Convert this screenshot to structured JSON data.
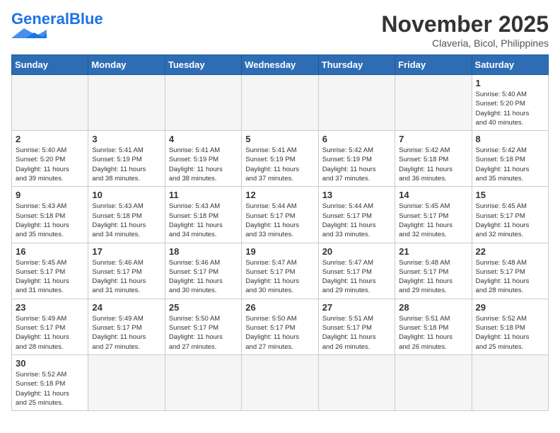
{
  "header": {
    "logo_general": "General",
    "logo_blue": "Blue",
    "month_title": "November 2025",
    "subtitle": "Claveria, Bicol, Philippines"
  },
  "weekdays": [
    "Sunday",
    "Monday",
    "Tuesday",
    "Wednesday",
    "Thursday",
    "Friday",
    "Saturday"
  ],
  "weeks": [
    [
      {
        "day": "",
        "info": ""
      },
      {
        "day": "",
        "info": ""
      },
      {
        "day": "",
        "info": ""
      },
      {
        "day": "",
        "info": ""
      },
      {
        "day": "",
        "info": ""
      },
      {
        "day": "",
        "info": ""
      },
      {
        "day": "1",
        "info": "Sunrise: 5:40 AM\nSunset: 5:20 PM\nDaylight: 11 hours\nand 40 minutes."
      }
    ],
    [
      {
        "day": "2",
        "info": "Sunrise: 5:40 AM\nSunset: 5:20 PM\nDaylight: 11 hours\nand 39 minutes."
      },
      {
        "day": "3",
        "info": "Sunrise: 5:41 AM\nSunset: 5:19 PM\nDaylight: 11 hours\nand 38 minutes."
      },
      {
        "day": "4",
        "info": "Sunrise: 5:41 AM\nSunset: 5:19 PM\nDaylight: 11 hours\nand 38 minutes."
      },
      {
        "day": "5",
        "info": "Sunrise: 5:41 AM\nSunset: 5:19 PM\nDaylight: 11 hours\nand 37 minutes."
      },
      {
        "day": "6",
        "info": "Sunrise: 5:42 AM\nSunset: 5:19 PM\nDaylight: 11 hours\nand 37 minutes."
      },
      {
        "day": "7",
        "info": "Sunrise: 5:42 AM\nSunset: 5:18 PM\nDaylight: 11 hours\nand 36 minutes."
      },
      {
        "day": "8",
        "info": "Sunrise: 5:42 AM\nSunset: 5:18 PM\nDaylight: 11 hours\nand 35 minutes."
      }
    ],
    [
      {
        "day": "9",
        "info": "Sunrise: 5:43 AM\nSunset: 5:18 PM\nDaylight: 11 hours\nand 35 minutes."
      },
      {
        "day": "10",
        "info": "Sunrise: 5:43 AM\nSunset: 5:18 PM\nDaylight: 11 hours\nand 34 minutes."
      },
      {
        "day": "11",
        "info": "Sunrise: 5:43 AM\nSunset: 5:18 PM\nDaylight: 11 hours\nand 34 minutes."
      },
      {
        "day": "12",
        "info": "Sunrise: 5:44 AM\nSunset: 5:17 PM\nDaylight: 11 hours\nand 33 minutes."
      },
      {
        "day": "13",
        "info": "Sunrise: 5:44 AM\nSunset: 5:17 PM\nDaylight: 11 hours\nand 33 minutes."
      },
      {
        "day": "14",
        "info": "Sunrise: 5:45 AM\nSunset: 5:17 PM\nDaylight: 11 hours\nand 32 minutes."
      },
      {
        "day": "15",
        "info": "Sunrise: 5:45 AM\nSunset: 5:17 PM\nDaylight: 11 hours\nand 32 minutes."
      }
    ],
    [
      {
        "day": "16",
        "info": "Sunrise: 5:45 AM\nSunset: 5:17 PM\nDaylight: 11 hours\nand 31 minutes."
      },
      {
        "day": "17",
        "info": "Sunrise: 5:46 AM\nSunset: 5:17 PM\nDaylight: 11 hours\nand 31 minutes."
      },
      {
        "day": "18",
        "info": "Sunrise: 5:46 AM\nSunset: 5:17 PM\nDaylight: 11 hours\nand 30 minutes."
      },
      {
        "day": "19",
        "info": "Sunrise: 5:47 AM\nSunset: 5:17 PM\nDaylight: 11 hours\nand 30 minutes."
      },
      {
        "day": "20",
        "info": "Sunrise: 5:47 AM\nSunset: 5:17 PM\nDaylight: 11 hours\nand 29 minutes."
      },
      {
        "day": "21",
        "info": "Sunrise: 5:48 AM\nSunset: 5:17 PM\nDaylight: 11 hours\nand 29 minutes."
      },
      {
        "day": "22",
        "info": "Sunrise: 5:48 AM\nSunset: 5:17 PM\nDaylight: 11 hours\nand 28 minutes."
      }
    ],
    [
      {
        "day": "23",
        "info": "Sunrise: 5:49 AM\nSunset: 5:17 PM\nDaylight: 11 hours\nand 28 minutes."
      },
      {
        "day": "24",
        "info": "Sunrise: 5:49 AM\nSunset: 5:17 PM\nDaylight: 11 hours\nand 27 minutes."
      },
      {
        "day": "25",
        "info": "Sunrise: 5:50 AM\nSunset: 5:17 PM\nDaylight: 11 hours\nand 27 minutes."
      },
      {
        "day": "26",
        "info": "Sunrise: 5:50 AM\nSunset: 5:17 PM\nDaylight: 11 hours\nand 27 minutes."
      },
      {
        "day": "27",
        "info": "Sunrise: 5:51 AM\nSunset: 5:17 PM\nDaylight: 11 hours\nand 26 minutes."
      },
      {
        "day": "28",
        "info": "Sunrise: 5:51 AM\nSunset: 5:18 PM\nDaylight: 11 hours\nand 26 minutes."
      },
      {
        "day": "29",
        "info": "Sunrise: 5:52 AM\nSunset: 5:18 PM\nDaylight: 11 hours\nand 25 minutes."
      }
    ],
    [
      {
        "day": "30",
        "info": "Sunrise: 5:52 AM\nSunset: 5:18 PM\nDaylight: 11 hours\nand 25 minutes."
      },
      {
        "day": "",
        "info": ""
      },
      {
        "day": "",
        "info": ""
      },
      {
        "day": "",
        "info": ""
      },
      {
        "day": "",
        "info": ""
      },
      {
        "day": "",
        "info": ""
      },
      {
        "day": "",
        "info": ""
      }
    ]
  ]
}
